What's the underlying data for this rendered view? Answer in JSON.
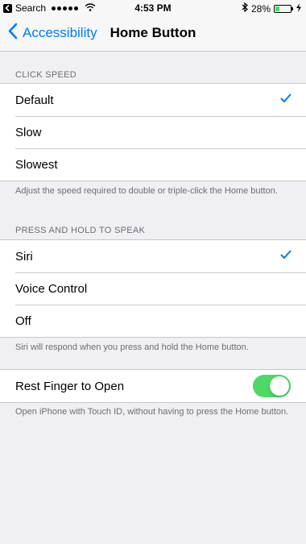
{
  "status_bar": {
    "back_app": "Search",
    "time": "4:53 PM",
    "battery_percent": "28%",
    "battery_level": 0.28,
    "signal_dots": 5,
    "icons": [
      "back-arrow-icon",
      "wifi-icon",
      "bluetooth-icon",
      "battery-icon",
      "charging-bolt-icon"
    ]
  },
  "nav": {
    "back_label": "Accessibility",
    "title": "Home Button"
  },
  "click_speed": {
    "header": "CLICK SPEED",
    "options": [
      {
        "label": "Default",
        "selected": true
      },
      {
        "label": "Slow",
        "selected": false
      },
      {
        "label": "Slowest",
        "selected": false
      }
    ],
    "footer": "Adjust the speed required to double or triple-click the Home button."
  },
  "press_hold": {
    "header": "PRESS AND HOLD TO SPEAK",
    "options": [
      {
        "label": "Siri",
        "selected": true
      },
      {
        "label": "Voice Control",
        "selected": false
      },
      {
        "label": "Off",
        "selected": false
      }
    ],
    "footer": "Siri will respond when you press and hold the Home button."
  },
  "rest_finger": {
    "label": "Rest Finger to Open",
    "enabled": true,
    "footer": "Open iPhone with Touch ID, without having to press the Home button."
  },
  "colors": {
    "accent": "#007aff",
    "toggle_on": "#4cd964",
    "background": "#efeff4",
    "secondary_text": "#6d6d72"
  }
}
